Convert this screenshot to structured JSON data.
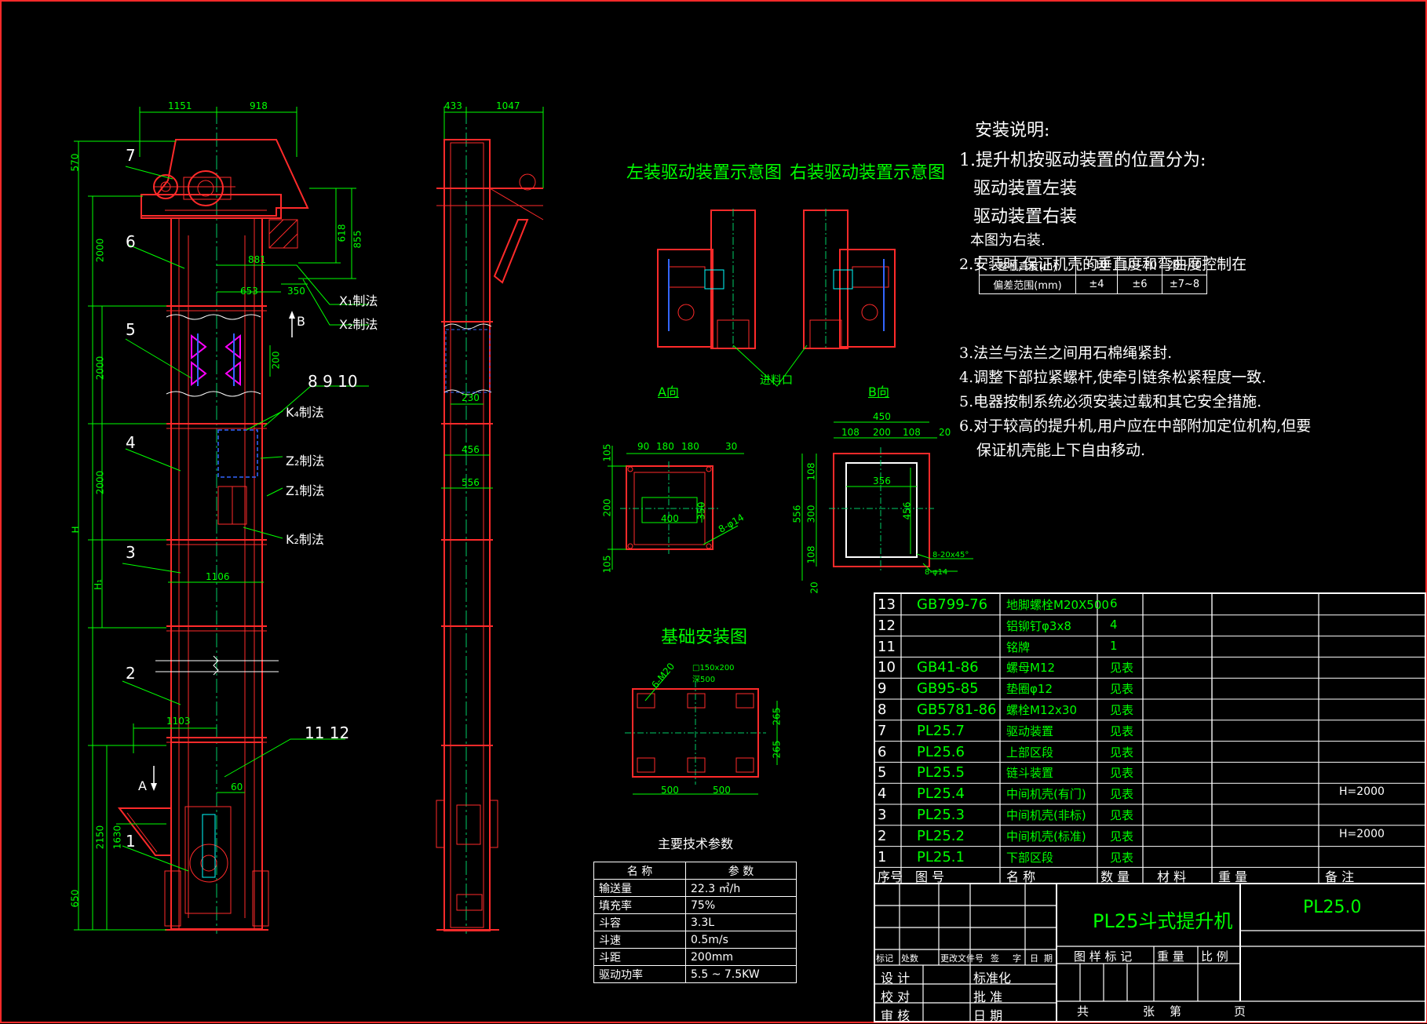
{
  "drawing": {
    "title": "PL25斗式提升机",
    "code": "PL25.0"
  },
  "colors": {
    "background": "#000000",
    "frame": "#ff2a2a",
    "dim": "#00ff00",
    "center": "#00cc66",
    "text": "#ffffff",
    "cyan": "#00ffff",
    "blue": "#3366ff",
    "magenta": "#ff00ff"
  },
  "elevation_front": {
    "top_dims": [
      "1151",
      "918"
    ],
    "left_dims": [
      "570",
      "2000",
      "2000",
      "2000",
      "H",
      "H₁",
      "2150",
      "650",
      "1630"
    ],
    "right_dims": [
      "618",
      "855",
      "881",
      "653",
      "350",
      "200"
    ],
    "mid_dims": [
      "1106",
      "1103",
      "60"
    ],
    "part_numbers": [
      "7",
      "6",
      "5",
      "4",
      "3",
      "2",
      "1"
    ],
    "callouts": [
      {
        "label": "X₁制法"
      },
      {
        "label": "X₂制法"
      },
      {
        "label": "8  9  10"
      },
      {
        "label": "K₄制法"
      },
      {
        "label": "Z₂制法"
      },
      {
        "label": "Z₁制法"
      },
      {
        "label": "K₂制法"
      },
      {
        "label": "11  12"
      }
    ],
    "view_a": "A",
    "view_b": "B"
  },
  "elevation_side": {
    "top_dims": [
      "433",
      "1047"
    ],
    "dims": [
      "230",
      "456",
      "556"
    ]
  },
  "drive_sketch": {
    "left_title": "左装驱动装置示意图",
    "right_title": "右装驱动装置示意图",
    "feed_label": "进料口",
    "view_a_label": "A向",
    "view_b_label": "B向"
  },
  "flange_a": {
    "top_dims": [
      "90",
      "180",
      "180",
      "30"
    ],
    "left_dims": [
      "105",
      "200",
      "105"
    ],
    "inner_dims": [
      "400",
      "350"
    ],
    "hole": "8-φ14"
  },
  "flange_b": {
    "top_dims": [
      "450",
      "108",
      "200",
      "108",
      "20"
    ],
    "left_dims": [
      "556",
      "108",
      "300",
      "108",
      "20"
    ],
    "inner_dims": [
      "356",
      "456"
    ],
    "chamfer": "8-20x45°",
    "hole": "8-φ14"
  },
  "foundation": {
    "title": "基础安装图",
    "bolt": "6-M20",
    "pocket": "□150x200 深500",
    "bottom_dims": [
      "500",
      "500"
    ],
    "right_dims": [
      "265",
      "265"
    ]
  },
  "notes": {
    "title": "安装说明:",
    "line1": "1.提升机按驱动装置的位置分为:",
    "line1a": "驱动装置左装",
    "line1b": "驱动装置右装",
    "line1c": "本图为右装.",
    "line2": "2.安装时,保证机壳的垂直度和弯曲度控制在",
    "line3": "3.法兰与法兰之间用石棉绳紧封.",
    "line4": "4.调整下部拉紧螺杆,使牵引链条松紧程度一致.",
    "line5": "5.电器按制系统必须安装过载和其它安全措施.",
    "line6": "6.对于较高的提升机,用户应在中部附加定位机构,但要",
    "line6b": "保证机壳能上下自由移动."
  },
  "deviation_table": {
    "row1": [
      "整机高度(m)",
      "<10",
      "10~20",
      "20~40"
    ],
    "row2": [
      "偏差范围(mm)",
      "±4",
      "±6",
      "±7~8"
    ]
  },
  "tech_params": {
    "caption": "主要技术参数",
    "header": [
      "名  称",
      "参  数"
    ],
    "rows": [
      [
        "输送量",
        "22.3 ㎥/h"
      ],
      [
        "填充率",
        "75%"
      ],
      [
        "斗容",
        "3.3L"
      ],
      [
        "斗速",
        "0.5m/s"
      ],
      [
        "斗距",
        "200mm"
      ],
      [
        "驱动功率",
        "5.5 ~ 7.5KW"
      ]
    ]
  },
  "bom": {
    "header": [
      "序号",
      "图     号",
      "名     称",
      "数  量",
      "材  料",
      "重       量",
      "备     注"
    ],
    "rows": [
      [
        "13",
        "GB799-76",
        "地脚螺栓M20X500",
        "6",
        "",
        ""
      ],
      [
        "12",
        "",
        "铝铆钉φ3x8",
        "4",
        "",
        ""
      ],
      [
        "11",
        "",
        "铭牌",
        "1",
        "",
        ""
      ],
      [
        "10",
        "GB41-86",
        "螺母M12",
        "见表",
        "",
        ""
      ],
      [
        "9",
        "GB95-85",
        "垫圈φ12",
        "见表",
        "",
        ""
      ],
      [
        "8",
        "GB5781-86",
        "螺栓M12x30",
        "见表",
        "",
        ""
      ],
      [
        "7",
        "PL25.7",
        "驱动装置",
        "见表",
        "",
        ""
      ],
      [
        "6",
        "PL25.6",
        "上部区段",
        "见表",
        "",
        ""
      ],
      [
        "5",
        "PL25.5",
        "链斗装置",
        "见表",
        "",
        ""
      ],
      [
        "4",
        "PL25.4",
        "中间机壳(有门)",
        "见表",
        "",
        "H=2000"
      ],
      [
        "3",
        "PL25.3",
        "中间机壳(非标)",
        "见表",
        "",
        ""
      ],
      [
        "2",
        "PL25.2",
        "中间机壳(标准)",
        "见表",
        "",
        "H=2000"
      ],
      [
        "1",
        "PL25.1",
        "下部区段",
        "见表",
        "",
        ""
      ]
    ]
  },
  "title_block": {
    "rev_row": [
      "标记",
      "处数",
      "更改文件号",
      "签",
      "字",
      "日",
      "期"
    ],
    "design": "设  计",
    "standard": "标准化",
    "check": "校  对",
    "approve": "批  准",
    "review": "审  核",
    "date": "日  期",
    "mark_header": [
      "图 样 标 记",
      "重  量",
      "比  例"
    ],
    "sheet": [
      "共",
      "张",
      "第",
      "页"
    ]
  }
}
